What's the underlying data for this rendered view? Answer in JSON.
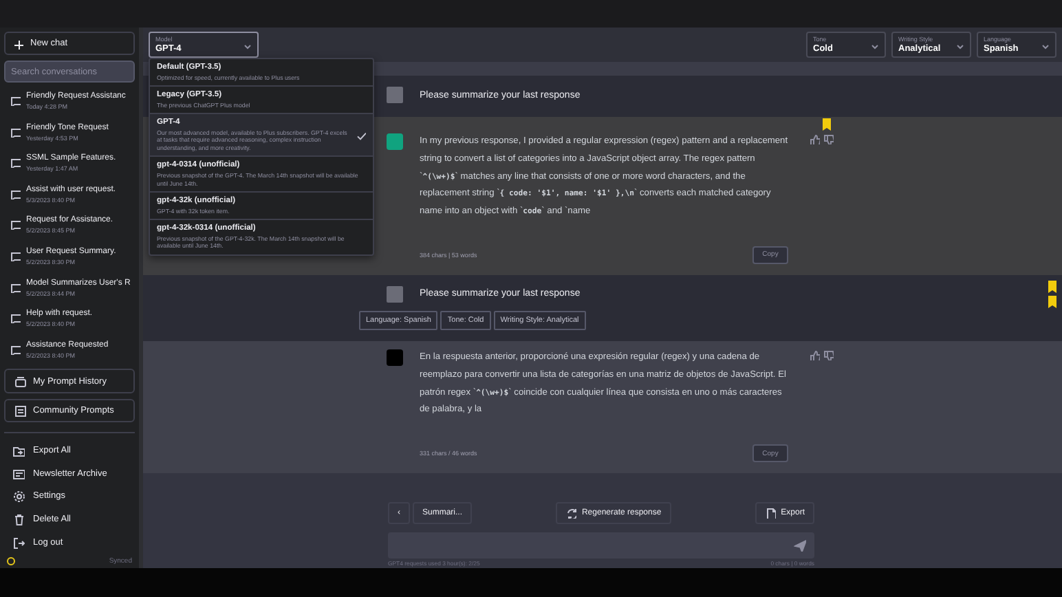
{
  "sidebar": {
    "new_chat": "New chat",
    "search": {
      "placeholder": "Search conversations"
    },
    "conversations": [
      {
        "title": "Friendly Request Assistanc",
        "time": "Today 4:28 PM"
      },
      {
        "title": "Friendly Tone Request",
        "time": "Yesterday 4:53 PM"
      },
      {
        "title": "SSML Sample Features.",
        "time": "Yesterday 1:47 AM"
      },
      {
        "title": "Assist with user request.",
        "time": "5/3/2023 8:40 PM"
      },
      {
        "title": "Request for Assistance.",
        "time": "5/2/2023 8:45 PM"
      },
      {
        "title": "User Request Summary.",
        "time": "5/2/2023 8:30 PM"
      },
      {
        "title": "Model Summarizes User's R",
        "time": "5/2/2023 8:44 PM"
      },
      {
        "title": "Help with request.",
        "time": "5/2/2023 8:40 PM"
      },
      {
        "title": "Assistance Requested",
        "time": "5/2/2023 8:40 PM"
      }
    ],
    "prompt_links": [
      {
        "label": "My Prompt History",
        "kind": "history"
      },
      {
        "label": "Community Prompts",
        "kind": "community"
      }
    ],
    "actions": [
      {
        "label": "Export All",
        "kind": "export"
      },
      {
        "label": "Newsletter Archive",
        "kind": "newsletter"
      },
      {
        "label": "Settings",
        "kind": "settings"
      },
      {
        "label": "Delete All",
        "kind": "delete"
      },
      {
        "label": "Log out",
        "kind": "logout"
      }
    ],
    "sync_status": "Synced"
  },
  "top_bar": {
    "model": {
      "label": "Model",
      "value": "GPT-4",
      "expanded": true,
      "options": [
        {
          "name": "Default (GPT-3.5)",
          "description": "Optimized for speed, currently available to Plus users",
          "selected": false
        },
        {
          "name": "Legacy (GPT-3.5)",
          "description": "The previous ChatGPT Plus model",
          "selected": false
        },
        {
          "name": "GPT-4",
          "description": "Our most advanced model, available to Plus subscribers. GPT-4 excels at tasks that require advanced reasoning, complex instruction understanding, and more creativity.",
          "selected": true
        },
        {
          "name": "gpt-4-0314 (unofficial)",
          "description": "Previous snapshot of the GPT-4. The March 14th snapshot will be available until June 14th.",
          "selected": false
        },
        {
          "name": "gpt-4-32k (unofficial)",
          "description": "GPT-4 with 32k token item.",
          "selected": false
        },
        {
          "name": "gpt-4-32k-0314 (unofficial)",
          "description": "Previous snapshot of the GPT-4-32k. The March 14th snapshot will be available until June 14th.",
          "selected": false
        }
      ]
    },
    "selects": [
      {
        "label": "Tone",
        "value": "Cold"
      },
      {
        "label": "Writing Style",
        "value": "Analytical"
      },
      {
        "label": "Language",
        "value": "Spanish"
      }
    ]
  },
  "messages": [
    {
      "kind": "user",
      "text": "Please summarize your last response",
      "bookmarked": false
    },
    {
      "kind": "assistant",
      "text": "In my previous response, I provided a regular expression (regex) pattern and a replacement string to convert a list of categories into a JavaScript object array. The regex pattern `**^(\\w+)$**` matches any line that consists of one or more word characters, and the replacement string `**{ code: '$1', name: '$1' },\\n**` converts each matched category name into an object with `**code**` and `name",
      "stats": "384 chars | 53 words",
      "copy": "Copy",
      "bookmarked": true
    },
    {
      "kind": "user",
      "text": "Please summarize your last response",
      "tags": [
        "Language: Spanish",
        "Tone: Cold",
        "Writing Style: Analytical"
      ],
      "bookmarked": true
    },
    {
      "kind": "assistant",
      "text": "En la respuesta anterior, proporcioné una expresión regular (regex) y una cadena de reemplazo para convertir una lista de categorías en una matriz de objetos de JavaScript. El patrón regex `**^(\\w+)$**` coincide con cualquier línea que consista en uno o más caracteres de palabra, y la",
      "stats": "331 chars / 46 words",
      "copy": "Copy",
      "bookmarked": false
    }
  ],
  "composer": {
    "back": "‹",
    "prompt_chip": "Summari...",
    "regenerate": "Regenerate response",
    "export": "Export",
    "usage": "GPT4 requests used 3 hour(s): 2/25",
    "counter": "0 chars | 0 words"
  }
}
